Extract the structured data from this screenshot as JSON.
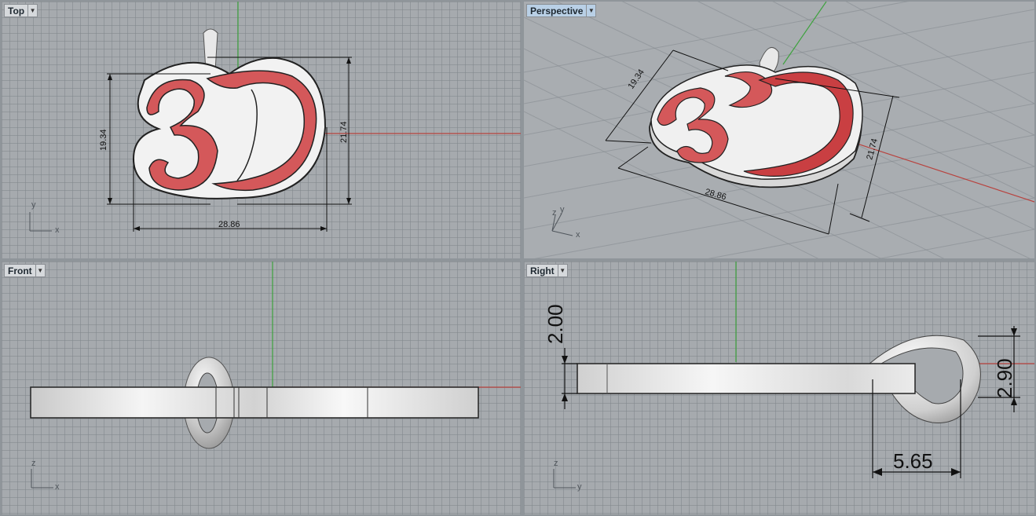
{
  "viewports": {
    "top": {
      "label": "Top",
      "dims": {
        "height": "19.34",
        "height_full": "21.74",
        "width": "28.86"
      },
      "axes": {
        "a": "y",
        "b": "x"
      }
    },
    "perspective": {
      "label": "Perspective",
      "dims": {
        "height": "19.34",
        "height_full": "21.74",
        "width": "28.86"
      },
      "axes": {
        "a": "z",
        "b": "y",
        "c": "x"
      }
    },
    "front": {
      "label": "Front",
      "axes": {
        "a": "z",
        "b": "x"
      }
    },
    "right": {
      "label": "Right",
      "dims": {
        "thickness": "2.00",
        "bail_height": "2.90",
        "bail_width": "5.65"
      },
      "axes": {
        "a": "z",
        "b": "y"
      }
    }
  },
  "model": {
    "text": "3D"
  },
  "colors": {
    "enamel": "#d4585a",
    "metal": "#eeeeee",
    "grid": "#a6aaae",
    "x_axis": "#b8433f",
    "y_axis": "#3ea23e"
  }
}
